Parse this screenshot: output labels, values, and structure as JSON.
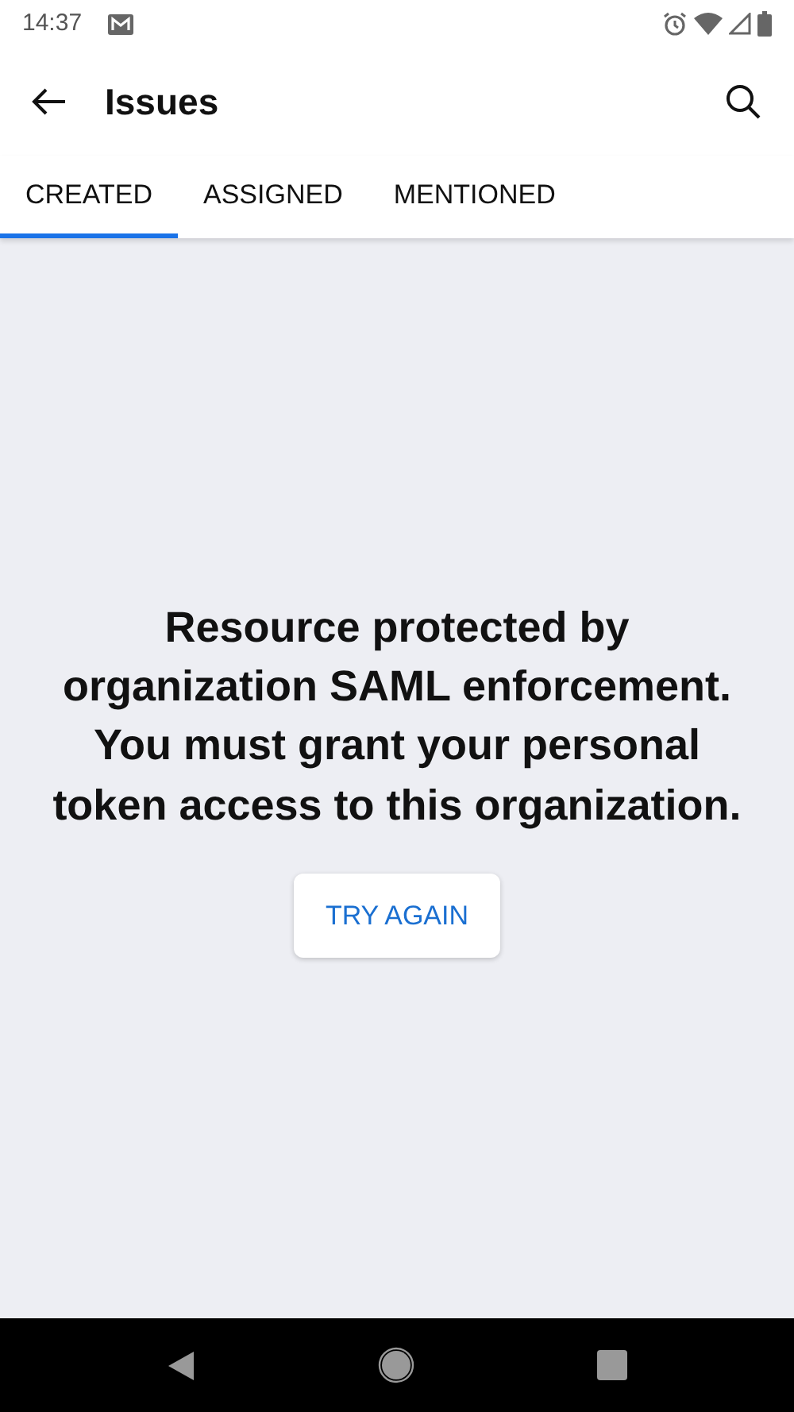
{
  "status_bar": {
    "time": "14:37"
  },
  "app_bar": {
    "title": "Issues"
  },
  "tabs": [
    {
      "label": "CREATED",
      "selected": true
    },
    {
      "label": "ASSIGNED",
      "selected": false
    },
    {
      "label": "MENTIONED",
      "selected": false
    }
  ],
  "error": {
    "message": "Resource protected by organization SAML enforcement. You must grant your personal token access to this organization.",
    "button": "TRY AGAIN"
  }
}
